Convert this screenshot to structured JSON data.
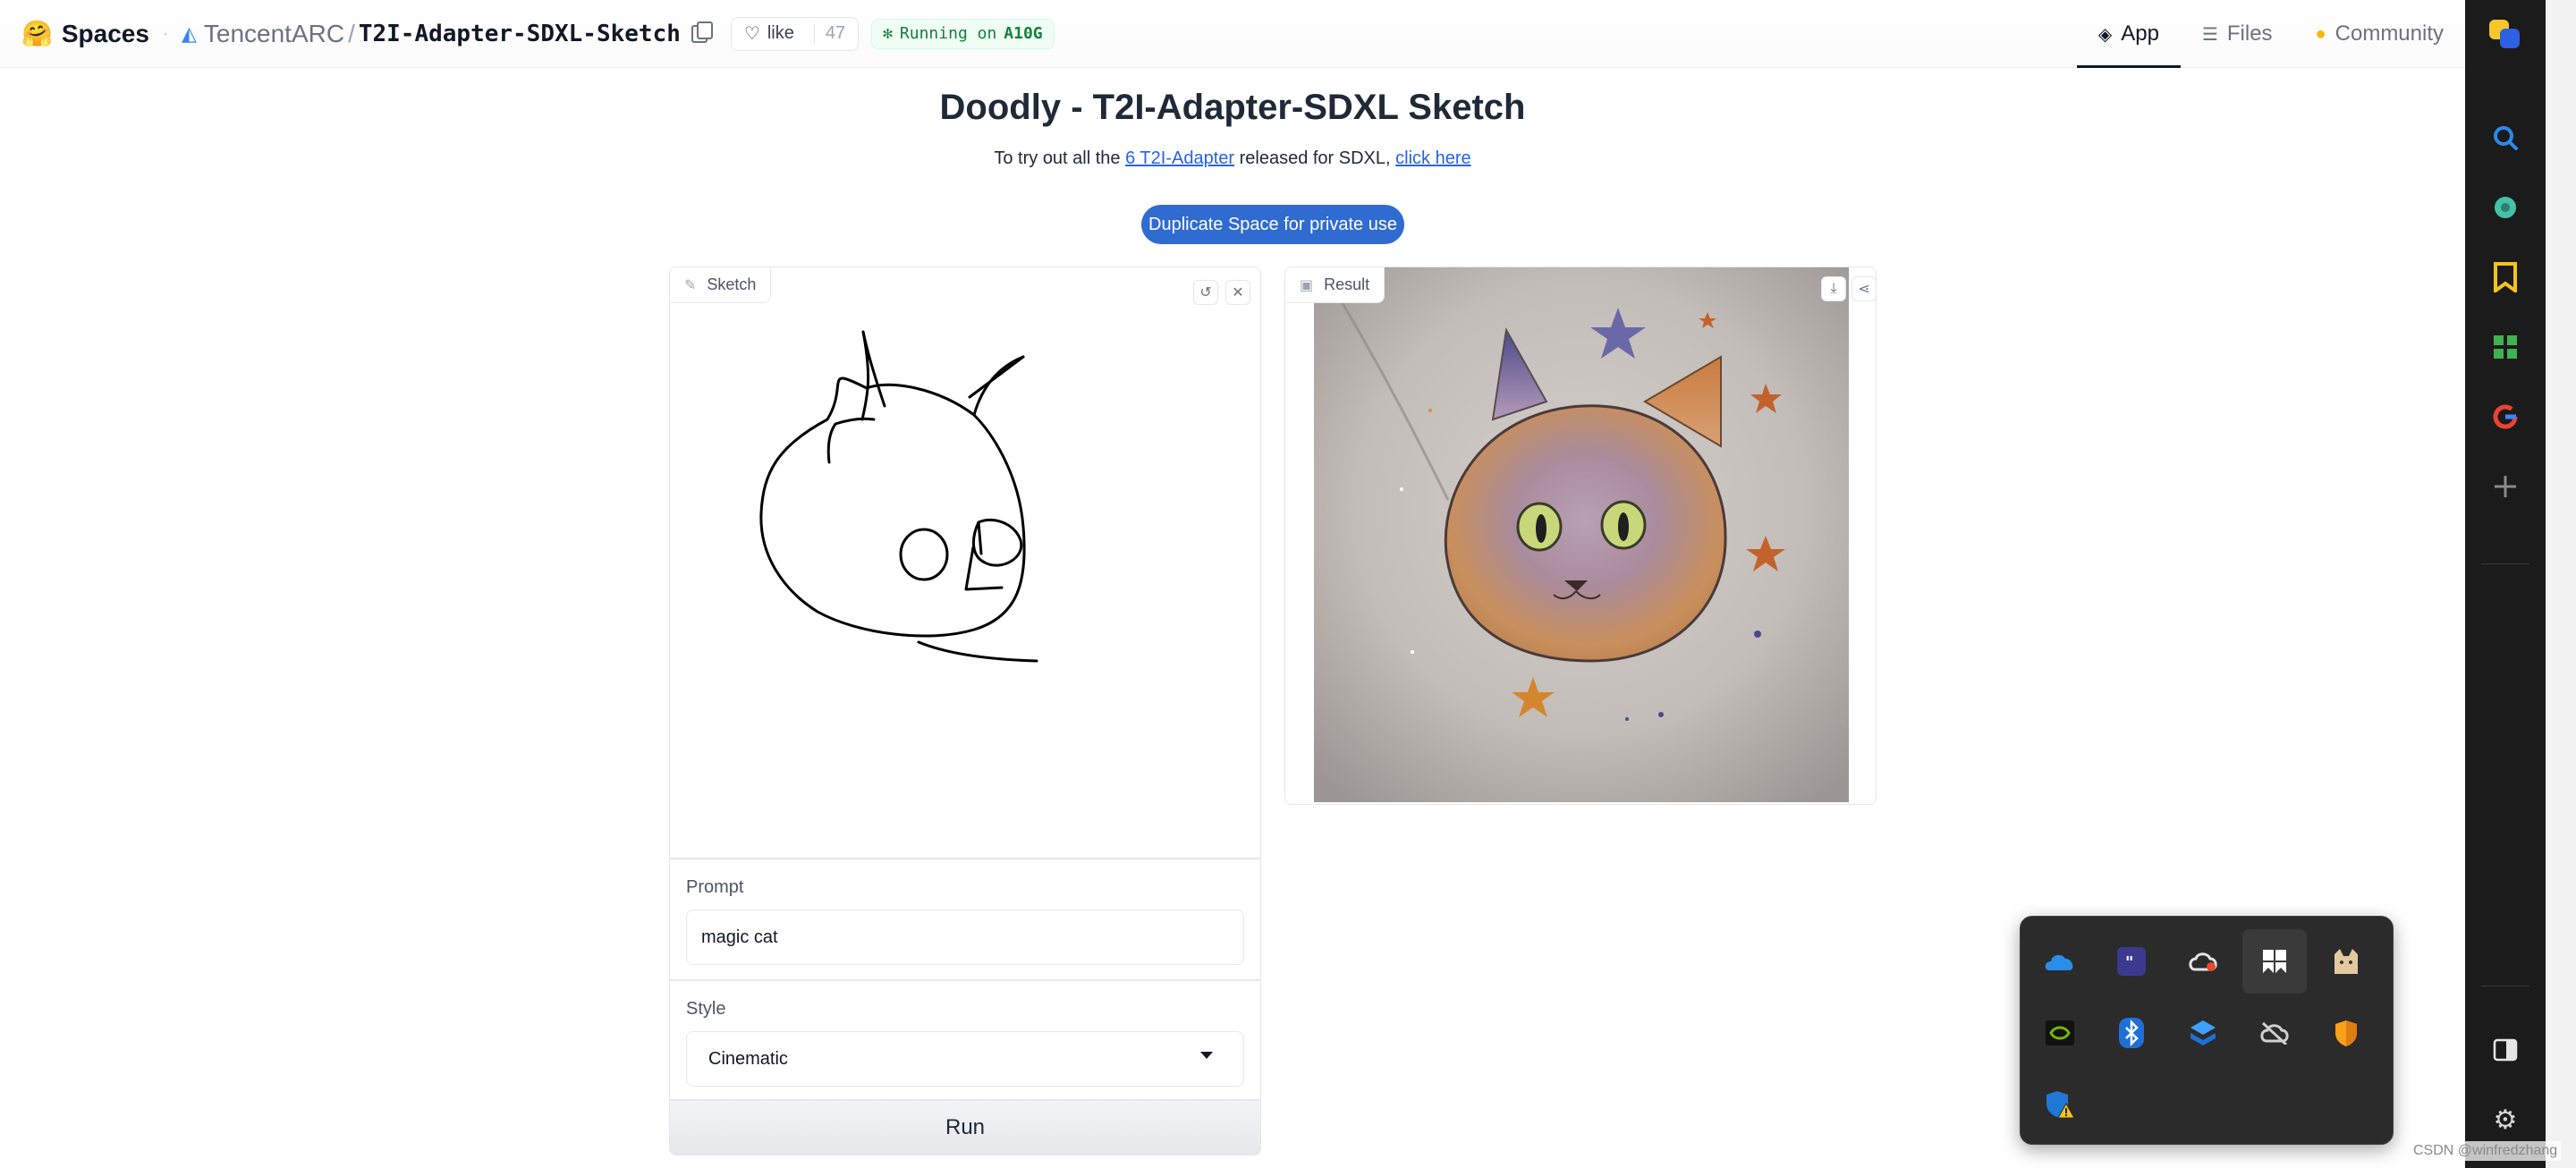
{
  "header": {
    "brand": "Spaces",
    "org": "TencentARC",
    "repo": "T2I-Adapter-SDXL-Sketch",
    "like_label": "like",
    "like_count": "47",
    "status_prefix": "Running on",
    "status_hardware": "A10G",
    "tabs": [
      {
        "label": "App",
        "icon": "cube-icon",
        "active": true
      },
      {
        "label": "Files",
        "icon": "files-icon",
        "active": false
      },
      {
        "label": "Community",
        "icon": "community-icon",
        "active": false
      }
    ]
  },
  "main": {
    "title": "Doodly - T2I-Adapter-SDXL Sketch",
    "subtitle_before": "To try out all the ",
    "subtitle_link1": "6 T2I-Adapter",
    "subtitle_middle": " released for SDXL, ",
    "subtitle_link2": "click here",
    "duplicate_button": "Duplicate Space for private use",
    "sketch_label": "Sketch",
    "result_label": "Result",
    "prompt_label": "Prompt",
    "prompt_value": "magic cat",
    "style_label": "Style",
    "style_value": "Cinematic",
    "run_button": "Run"
  },
  "watermark": "CSDN @winfredzhang",
  "colors": {
    "accent_button": "#2f6bd1",
    "link": "#2563eb",
    "status_green": "#15803d"
  }
}
